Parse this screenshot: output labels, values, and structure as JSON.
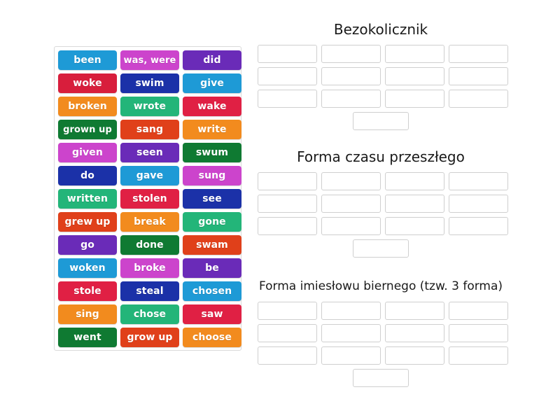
{
  "activity": {
    "type": "drag-and-drop-group-sort",
    "language": "pl"
  },
  "tile_pool": {
    "name": "word-tile-pool",
    "columns": 3,
    "rows": [
      [
        {
          "label": "been",
          "color": "#1e9ad6"
        },
        {
          "label": "was, were",
          "color": "#cc44cc"
        },
        {
          "label": "did",
          "color": "#6a2bb8"
        }
      ],
      [
        {
          "label": "woke",
          "color": "#d81e3c"
        },
        {
          "label": "swim",
          "color": "#1b31a8"
        },
        {
          "label": "give",
          "color": "#1e9ad6"
        }
      ],
      [
        {
          "label": "broken",
          "color": "#f28b1e"
        },
        {
          "label": "wrote",
          "color": "#23b579"
        },
        {
          "label": "wake",
          "color": "#e02044"
        }
      ],
      [
        {
          "label": "grown up",
          "color": "#0f7a32"
        },
        {
          "label": "sang",
          "color": "#e0401a"
        },
        {
          "label": "write",
          "color": "#f28b1e"
        }
      ],
      [
        {
          "label": "given",
          "color": "#cc44cc"
        },
        {
          "label": "seen",
          "color": "#6a2bb8"
        },
        {
          "label": "swum",
          "color": "#0f7a32"
        }
      ],
      [
        {
          "label": "do",
          "color": "#1b31a8"
        },
        {
          "label": "gave",
          "color": "#1e9ad6"
        },
        {
          "label": "sung",
          "color": "#cc44cc"
        }
      ],
      [
        {
          "label": "written",
          "color": "#23b579"
        },
        {
          "label": "stolen",
          "color": "#e02044"
        },
        {
          "label": "see",
          "color": "#1b31a8"
        }
      ],
      [
        {
          "label": "grew up",
          "color": "#e0401a"
        },
        {
          "label": "break",
          "color": "#f28b1e"
        },
        {
          "label": "gone",
          "color": "#23b579"
        }
      ],
      [
        {
          "label": "go",
          "color": "#6a2bb8"
        },
        {
          "label": "done",
          "color": "#0f7a32"
        },
        {
          "label": "swam",
          "color": "#e0401a"
        }
      ],
      [
        {
          "label": "woken",
          "color": "#1e9ad6"
        },
        {
          "label": "broke",
          "color": "#cc44cc"
        },
        {
          "label": "be",
          "color": "#6a2bb8"
        }
      ],
      [
        {
          "label": "stole",
          "color": "#e02044"
        },
        {
          "label": "steal",
          "color": "#1b31a8"
        },
        {
          "label": "chosen",
          "color": "#1e9ad6"
        }
      ],
      [
        {
          "label": "sing",
          "color": "#f28b1e"
        },
        {
          "label": "chose",
          "color": "#23b579"
        },
        {
          "label": "saw",
          "color": "#e02044"
        }
      ],
      [
        {
          "label": "went",
          "color": "#0f7a32"
        },
        {
          "label": "grow up",
          "color": "#e0401a"
        },
        {
          "label": "choose",
          "color": "#f28b1e"
        }
      ]
    ]
  },
  "sections": [
    {
      "id": "infinitive",
      "title": "Bezokolicznik",
      "slot_rows": [
        [
          "",
          "",
          "",
          ""
        ],
        [
          "",
          "",
          "",
          ""
        ],
        [
          "",
          "",
          "",
          ""
        ]
      ],
      "final_slot": "",
      "slot_count": 13
    },
    {
      "id": "past",
      "title": "Forma czasu przeszłego",
      "slot_rows": [
        [
          "",
          "",
          "",
          ""
        ],
        [
          "",
          "",
          "",
          ""
        ],
        [
          "",
          "",
          "",
          ""
        ]
      ],
      "final_slot": "",
      "slot_count": 13
    },
    {
      "id": "participle",
      "title": "Forma imiesłowu biernego (tzw. 3 forma)",
      "slot_rows": [
        [
          "",
          "",
          "",
          ""
        ],
        [
          "",
          "",
          "",
          ""
        ],
        [
          "",
          "",
          "",
          ""
        ]
      ],
      "final_slot": "",
      "slot_count": 13
    }
  ],
  "colors": {
    "background": "#ffffff",
    "pool_border": "#d9d9d9",
    "slot_border": "#cfcfcf",
    "title_text": "#1a1a1a",
    "tile_text": "#ffffff"
  }
}
